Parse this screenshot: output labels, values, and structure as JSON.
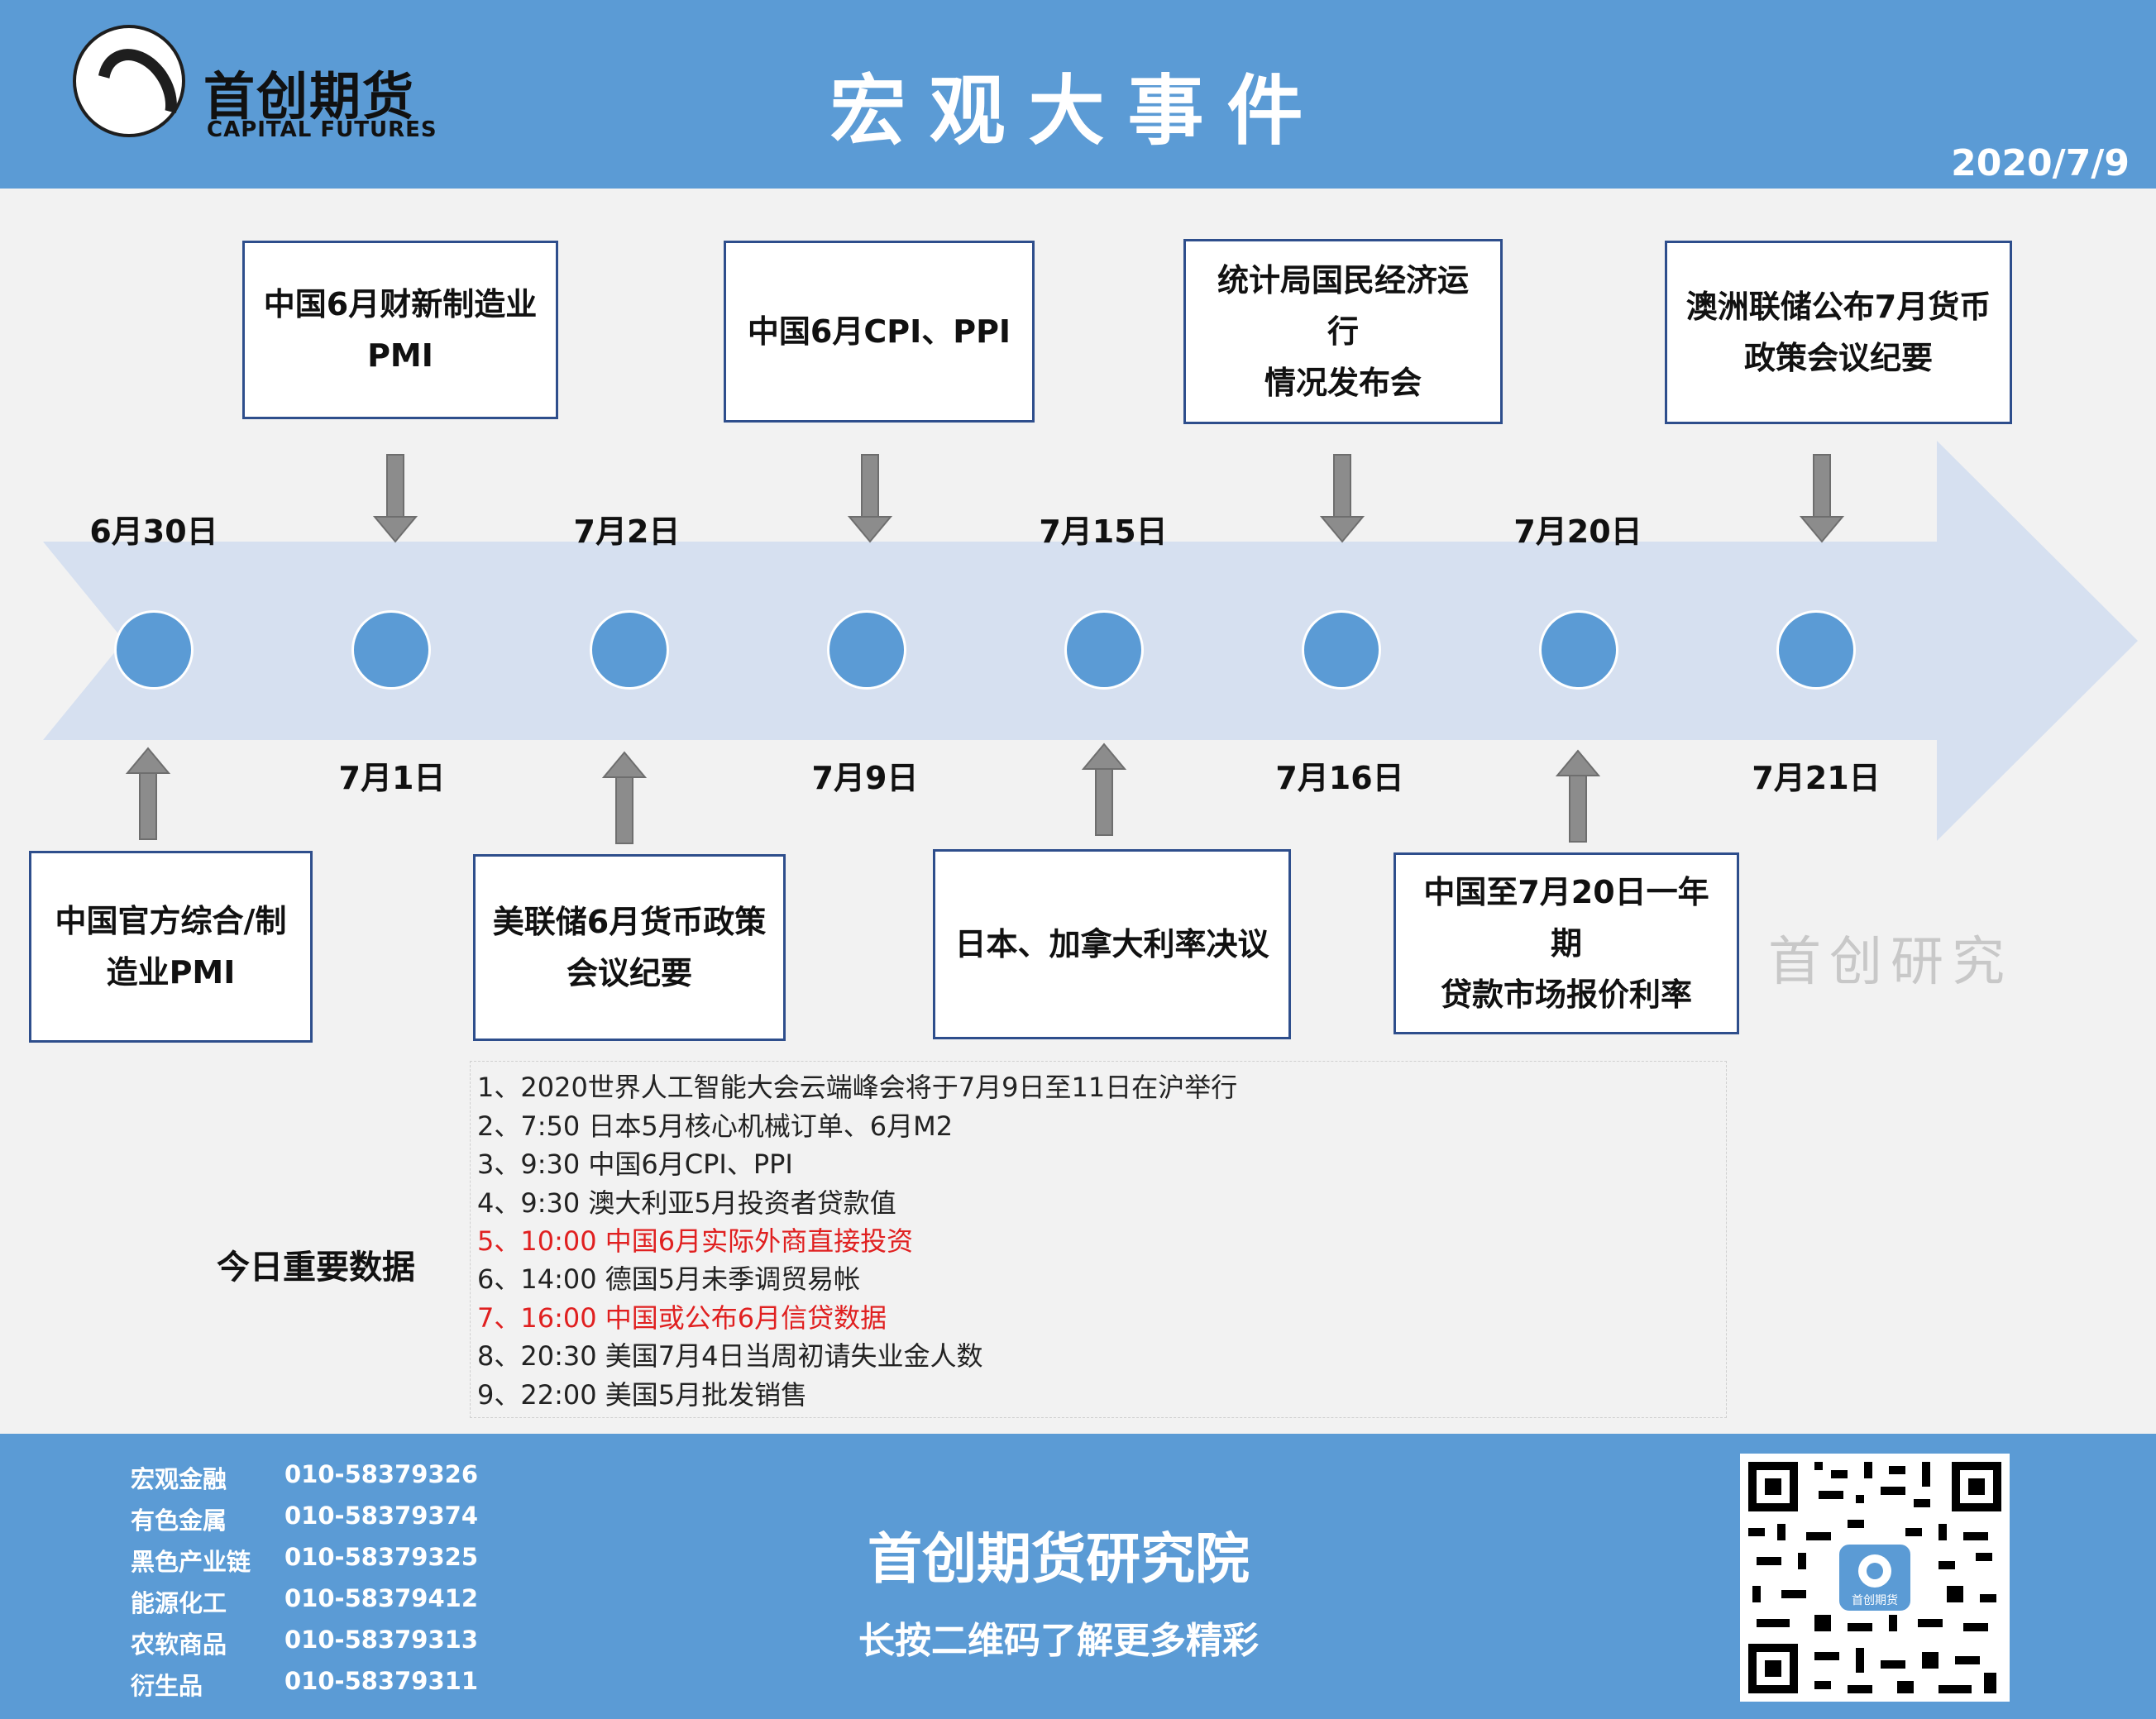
{
  "header": {
    "logo_cn": "首创期货",
    "logo_en": "CAPITAL FUTURES",
    "title": "宏观大事件",
    "date": "2020/7/9",
    "bg_color": "#5b9bd5"
  },
  "timeline": {
    "dates_top": [
      "6月30日",
      "7月2日",
      "7月15日",
      "7月20日"
    ],
    "dates_bottom": [
      "7月1日",
      "7月9日",
      "7月16日",
      "7月21日"
    ],
    "events_top": [
      {
        "lines": [
          "中国6月财新制造业",
          "PMI"
        ]
      },
      {
        "lines": [
          "中国6月CPI、PPI"
        ]
      },
      {
        "lines": [
          "统计局国民经济运行",
          "情况发布会"
        ]
      },
      {
        "lines": [
          "澳洲联储公布7月货币",
          "政策会议纪要"
        ]
      }
    ],
    "events_bottom": [
      {
        "lines": [
          "中国官方综合/制",
          "造业PMI"
        ]
      },
      {
        "lines": [
          "美联储6月货币政策",
          "会议纪要"
        ]
      },
      {
        "lines": [
          "日本、加拿大利率决议"
        ]
      },
      {
        "lines": [
          "中国至7月20日一年期",
          "贷款市场报价利率"
        ]
      }
    ],
    "watermark": "首创研究",
    "arrow_color": "#d6e0f0",
    "node_color": "#5b9bd5"
  },
  "data_section": {
    "title": "今日重要数据",
    "items": [
      {
        "text": "1、2020世界人工智能大会云端峰会将于7月9日至11日在沪举行",
        "highlight": false
      },
      {
        "text": "2、7:50 日本5月核心机械订单、6月M2",
        "highlight": false
      },
      {
        "text": "3、9:30 中国6月CPI、PPI",
        "highlight": false
      },
      {
        "text": "4、9:30 澳大利亚5月投资者贷款值",
        "highlight": false
      },
      {
        "text": "5、10:00 中国6月实际外商直接投资",
        "highlight": true
      },
      {
        "text": "6、14:00 德国5月未季调贸易帐",
        "highlight": false
      },
      {
        "text": "7、16:00 中国或公布6月信贷数据",
        "highlight": true
      },
      {
        "text": "8、20:30 美国7月4日当周初请失业金人数",
        "highlight": false
      },
      {
        "text": "9、22:00 美国5月批发销售",
        "highlight": false
      }
    ]
  },
  "footer": {
    "contacts": [
      {
        "name": "宏观金融",
        "phone": "010-58379326"
      },
      {
        "name": "有色金属",
        "phone": "010-58379374"
      },
      {
        "name": "黑色产业链",
        "phone": "010-58379325"
      },
      {
        "name": "能源化工",
        "phone": "010-58379412"
      },
      {
        "name": "农软商品",
        "phone": "010-58379313"
      },
      {
        "name": "衍生品",
        "phone": "010-58379311"
      }
    ],
    "title": "首创期货研究院",
    "subtitle": "长按二维码了解更多精彩",
    "qr_label": "首创期货"
  }
}
